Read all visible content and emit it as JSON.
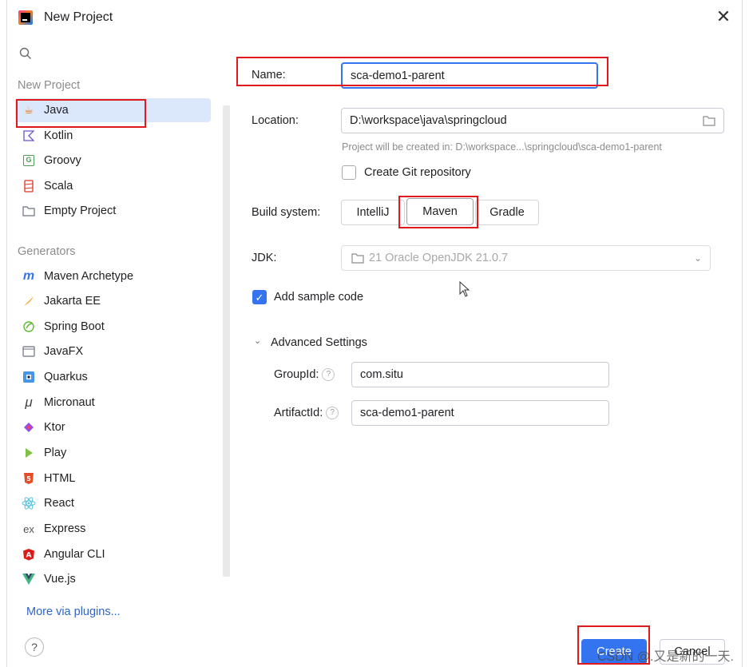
{
  "window": {
    "title": "New Project"
  },
  "sidebar": {
    "search_icon": "search-icon",
    "new_project_group": "New Project",
    "new_project_items": [
      {
        "label": "Java",
        "icon": "java-cup-icon",
        "selected": true
      },
      {
        "label": "Kotlin",
        "icon": "kotlin-icon"
      },
      {
        "label": "Groovy",
        "icon": "groovy-icon"
      },
      {
        "label": "Scala",
        "icon": "scala-icon"
      },
      {
        "label": "Empty Project",
        "icon": "folder-icon"
      }
    ],
    "generators_group": "Generators",
    "generator_items": [
      {
        "label": "Maven Archetype",
        "icon": "maven-icon"
      },
      {
        "label": "Jakarta EE",
        "icon": "jakarta-icon"
      },
      {
        "label": "Spring Boot",
        "icon": "spring-icon"
      },
      {
        "label": "JavaFX",
        "icon": "javafx-icon"
      },
      {
        "label": "Quarkus",
        "icon": "quarkus-icon"
      },
      {
        "label": "Micronaut",
        "icon": "micronaut-icon"
      },
      {
        "label": "Ktor",
        "icon": "ktor-icon"
      },
      {
        "label": "Play",
        "icon": "play-icon"
      },
      {
        "label": "HTML",
        "icon": "html5-icon"
      },
      {
        "label": "React",
        "icon": "react-icon"
      },
      {
        "label": "Express",
        "icon": "express-icon"
      },
      {
        "label": "Angular CLI",
        "icon": "angular-icon"
      },
      {
        "label": "Vue.js",
        "icon": "vue-icon"
      }
    ],
    "more_plugins": "More via plugins...",
    "help": "?"
  },
  "form": {
    "name_label": "Name:",
    "name_value": "sca-demo1-parent",
    "location_label": "Location:",
    "location_value": "D:\\workspace\\java\\springcloud",
    "location_hint": "Project will be created in: D:\\workspace...\\springcloud\\sca-demo1-parent",
    "git_label": "Create Git repository",
    "build_label": "Build system:",
    "build_options": [
      "IntelliJ",
      "Maven",
      "Gradle"
    ],
    "build_selected": "Maven",
    "jdk_label": "JDK:",
    "jdk_value": "21 Oracle OpenJDK 21.0.7",
    "sample_code_label": "Add sample code",
    "sample_code_checked": true,
    "advanced_label": "Advanced Settings",
    "group_id_label": "GroupId:",
    "group_id_value": "com.situ",
    "artifact_id_label": "ArtifactId:",
    "artifact_id_value": "sca-demo1-parent"
  },
  "buttons": {
    "create": "Create",
    "cancel": "Cancel"
  },
  "watermark": "CSDN @.又是新的一天.",
  "colors": {
    "accent": "#3574f0",
    "highlight": "#e0191d",
    "selected_bg": "#dbe8fb"
  }
}
